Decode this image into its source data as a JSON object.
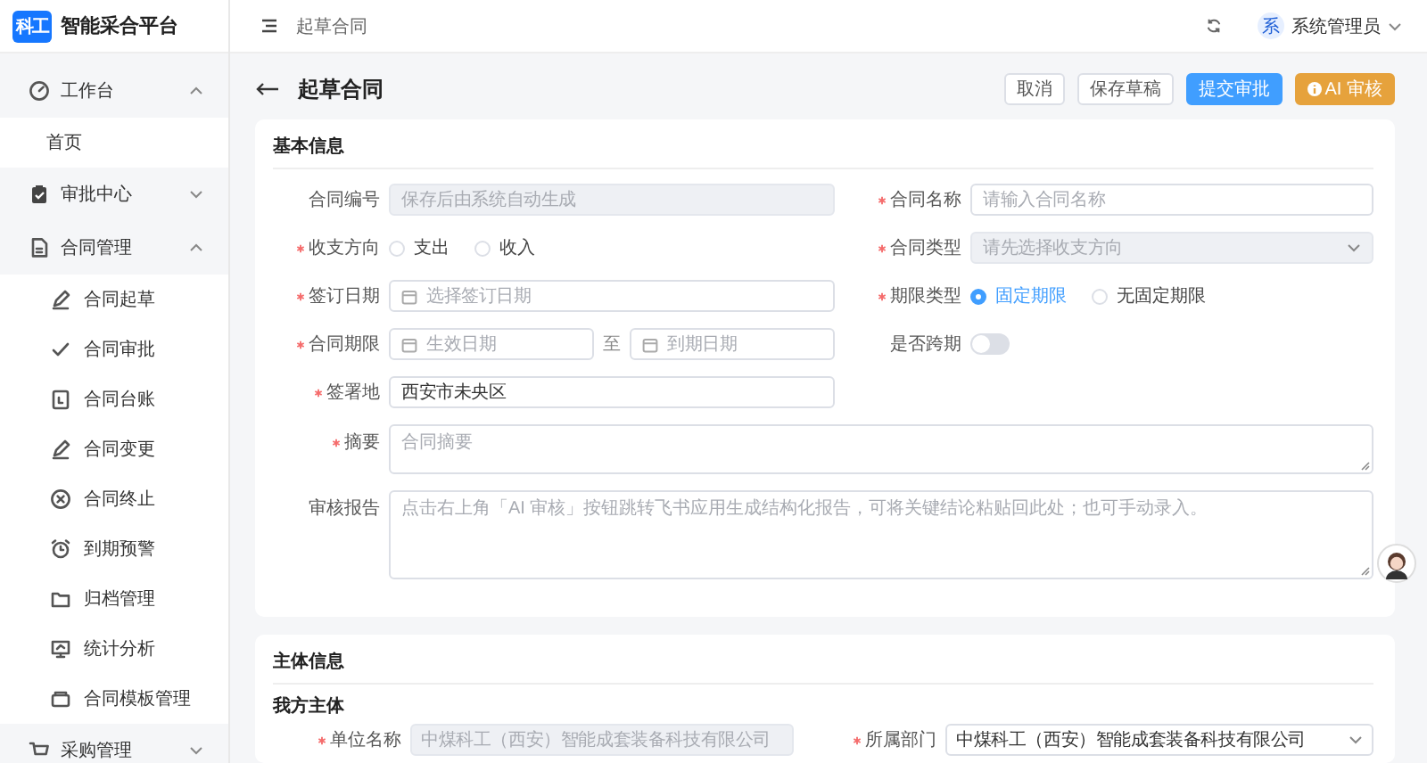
{
  "brand": {
    "logo": "科工",
    "name": "智能采合平台"
  },
  "sidebar": {
    "items": [
      {
        "label": "工作台",
        "expanded": true,
        "children": [
          {
            "label": "首页"
          }
        ]
      },
      {
        "label": "审批中心",
        "expanded": false
      },
      {
        "label": "合同管理",
        "expanded": true,
        "children": [
          {
            "label": "合同起草"
          },
          {
            "label": "合同审批"
          },
          {
            "label": "合同台账"
          },
          {
            "label": "合同变更"
          },
          {
            "label": "合同终止"
          },
          {
            "label": "到期预警"
          },
          {
            "label": "归档管理"
          },
          {
            "label": "统计分析"
          },
          {
            "label": "合同模板管理"
          }
        ]
      },
      {
        "label": "采购管理",
        "expanded": false
      }
    ]
  },
  "header": {
    "breadcrumb": "起草合同",
    "user": {
      "avatar": "系",
      "name": "系统管理员"
    }
  },
  "page": {
    "title": "起草合同",
    "buttons": [
      {
        "label": "取消",
        "kind": "default"
      },
      {
        "label": "保存草稿",
        "kind": "default"
      },
      {
        "label": "提交审批",
        "kind": "primary"
      },
      {
        "label": "AI 审核",
        "kind": "warning"
      }
    ]
  },
  "sections": [
    {
      "title": "基本信息",
      "rows": [
        [
          {
            "label": "合同编号",
            "required": false,
            "kind": "text",
            "placeholder": "保存后由系统自动生成",
            "disabled": true
          },
          {
            "label": "合同名称",
            "required": true,
            "kind": "text",
            "placeholder": "请输入合同名称",
            "disabled": false
          }
        ],
        [
          {
            "label": "收支方向",
            "required": true,
            "kind": "radio",
            "options": [
              {
                "label": "支出",
                "selected": false
              },
              {
                "label": "收入",
                "selected": false
              }
            ]
          },
          {
            "label": "合同类型",
            "required": true,
            "kind": "select",
            "placeholder": "请先选择收支方向",
            "disabled": true
          }
        ],
        [
          {
            "label": "签订日期",
            "required": true,
            "kind": "date",
            "placeholder": "选择签订日期"
          },
          {
            "label": "期限类型",
            "required": true,
            "kind": "radio",
            "options": [
              {
                "label": "固定期限",
                "selected": true
              },
              {
                "label": "无固定期限",
                "selected": false
              }
            ]
          }
        ],
        [
          {
            "label": "合同期限",
            "required": true,
            "kind": "daterange",
            "start": "生效日期",
            "separator": "至",
            "end": "到期日期"
          },
          {
            "label": "是否跨期",
            "required": false,
            "kind": "switch",
            "on": false
          }
        ],
        [
          {
            "label": "签署地",
            "required": true,
            "kind": "text",
            "value": "西安市未央区",
            "disabled": false
          }
        ],
        [
          {
            "label": "摘要",
            "required": true,
            "kind": "textarea",
            "placeholder": "合同摘要"
          }
        ],
        [
          {
            "label": "审核报告",
            "required": false,
            "kind": "textarea",
            "placeholder": "点击右上角「AI 审核」按钮跳转飞书应用生成结构化报告，可将关键结论粘贴回此处；也可手动录入。"
          }
        ]
      ]
    },
    {
      "title": "主体信息",
      "subsections": [
        {
          "title": "我方主体",
          "rows": [
            [
              {
                "label": "单位名称",
                "required": true,
                "kind": "text",
                "value": "中煤科工（西安）智能成套装备科技有限公司",
                "disabled": true
              },
              {
                "label": "所属部门",
                "required": true,
                "kind": "select",
                "value": "中煤科工（西安）智能成套装备科技有限公司",
                "disabled": false
              }
            ]
          ]
        }
      ]
    }
  ]
}
